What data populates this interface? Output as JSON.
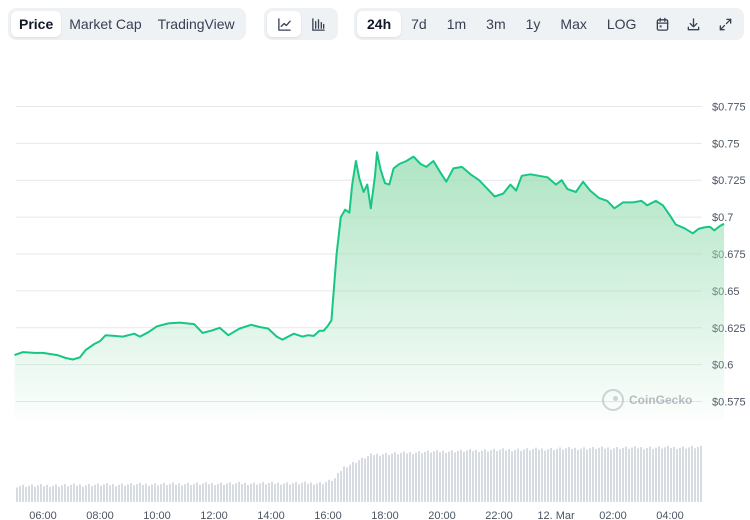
{
  "toolbar": {
    "view_tabs": [
      {
        "label": "Price",
        "active": true
      },
      {
        "label": "Market Cap",
        "active": false
      },
      {
        "label": "TradingView",
        "active": false
      }
    ],
    "chart_type_icons": [
      "line-chart-icon",
      "candlestick-chart-icon"
    ],
    "ranges": [
      {
        "label": "24h",
        "active": true
      },
      {
        "label": "7d",
        "active": false
      },
      {
        "label": "1m",
        "active": false
      },
      {
        "label": "3m",
        "active": false
      },
      {
        "label": "1y",
        "active": false
      },
      {
        "label": "Max",
        "active": false
      },
      {
        "label": "LOG",
        "active": false
      }
    ],
    "utility_icons": [
      "calendar-icon",
      "download-icon",
      "expand-icon"
    ]
  },
  "watermark": "CoinGecko",
  "colors": {
    "line": "#16c784",
    "fill_top": "#9fdfb8",
    "volume": "#d7dce2",
    "grid": "#e5e7eb"
  },
  "chart_data": {
    "type": "area",
    "x_labels": [
      "06:00",
      "08:00",
      "10:00",
      "12:00",
      "14:00",
      "16:00",
      "18:00",
      "20:00",
      "22:00",
      "12. Mar",
      "02:00",
      "04:00"
    ],
    "y_ticks": [
      "$0.575",
      "$0.6",
      "$0.625",
      "$0.65",
      "$0.675",
      "$0.7",
      "$0.725",
      "$0.75",
      "$0.775"
    ],
    "y_tick_values": [
      0.575,
      0.6,
      0.625,
      0.65,
      0.675,
      0.7,
      0.725,
      0.75,
      0.775
    ],
    "ylim": [
      0.5625,
      0.7875
    ],
    "xlim_hours": [
      5.0,
      29.0
    ],
    "grid": true,
    "price": [
      [
        5.0,
        0.6065
      ],
      [
        5.3,
        0.6085
      ],
      [
        5.7,
        0.608
      ],
      [
        6.0,
        0.608
      ],
      [
        6.5,
        0.6065
      ],
      [
        6.8,
        0.6045
      ],
      [
        7.05,
        0.6035
      ],
      [
        7.3,
        0.605
      ],
      [
        7.5,
        0.61
      ],
      [
        7.8,
        0.614
      ],
      [
        8.0,
        0.616
      ],
      [
        8.2,
        0.62
      ],
      [
        8.5,
        0.6195
      ],
      [
        8.8,
        0.619
      ],
      [
        9.0,
        0.62
      ],
      [
        9.2,
        0.621
      ],
      [
        9.4,
        0.619
      ],
      [
        9.7,
        0.622
      ],
      [
        10.0,
        0.626
      ],
      [
        10.4,
        0.628
      ],
      [
        10.8,
        0.6285
      ],
      [
        11.3,
        0.6275
      ],
      [
        11.6,
        0.6215
      ],
      [
        11.9,
        0.623
      ],
      [
        12.2,
        0.625
      ],
      [
        12.5,
        0.62
      ],
      [
        12.9,
        0.6245
      ],
      [
        13.3,
        0.627
      ],
      [
        13.6,
        0.6255
      ],
      [
        13.9,
        0.6245
      ],
      [
        14.2,
        0.619
      ],
      [
        14.4,
        0.617
      ],
      [
        14.8,
        0.621
      ],
      [
        15.1,
        0.619
      ],
      [
        15.3,
        0.62
      ],
      [
        15.5,
        0.6195
      ],
      [
        15.7,
        0.623
      ],
      [
        15.85,
        0.623
      ],
      [
        16.0,
        0.6265
      ],
      [
        16.12,
        0.63
      ],
      [
        16.3,
        0.675
      ],
      [
        16.45,
        0.7
      ],
      [
        16.6,
        0.705
      ],
      [
        16.75,
        0.703
      ],
      [
        16.85,
        0.722
      ],
      [
        16.98,
        0.738
      ],
      [
        17.1,
        0.726
      ],
      [
        17.25,
        0.717
      ],
      [
        17.38,
        0.722
      ],
      [
        17.5,
        0.706
      ],
      [
        17.65,
        0.728
      ],
      [
        17.72,
        0.744
      ],
      [
        17.85,
        0.732
      ],
      [
        18.0,
        0.723
      ],
      [
        18.15,
        0.722
      ],
      [
        18.3,
        0.733
      ],
      [
        18.5,
        0.736
      ],
      [
        18.75,
        0.738
      ],
      [
        19.0,
        0.741
      ],
      [
        19.25,
        0.736
      ],
      [
        19.45,
        0.734
      ],
      [
        19.7,
        0.738
      ],
      [
        19.95,
        0.73
      ],
      [
        20.15,
        0.724
      ],
      [
        20.4,
        0.733
      ],
      [
        20.7,
        0.734
      ],
      [
        21.0,
        0.729
      ],
      [
        21.3,
        0.725
      ],
      [
        21.6,
        0.719
      ],
      [
        21.85,
        0.714
      ],
      [
        22.15,
        0.716
      ],
      [
        22.4,
        0.722
      ],
      [
        22.6,
        0.718
      ],
      [
        22.8,
        0.728
      ],
      [
        23.1,
        0.729
      ],
      [
        23.4,
        0.728
      ],
      [
        23.7,
        0.727
      ],
      [
        24.0,
        0.722
      ],
      [
        24.2,
        0.725
      ],
      [
        24.4,
        0.719
      ],
      [
        24.7,
        0.717
      ],
      [
        24.95,
        0.724
      ],
      [
        25.2,
        0.718
      ],
      [
        25.5,
        0.713
      ],
      [
        25.8,
        0.711
      ],
      [
        26.05,
        0.706
      ],
      [
        26.35,
        0.71
      ],
      [
        26.7,
        0.71
      ],
      [
        27.0,
        0.711
      ],
      [
        27.2,
        0.708
      ],
      [
        27.5,
        0.711
      ],
      [
        27.75,
        0.708
      ],
      [
        28.0,
        0.701
      ],
      [
        28.2,
        0.695
      ],
      [
        28.5,
        0.6925
      ],
      [
        28.8,
        0.689
      ],
      [
        29.0,
        0.692
      ],
      [
        29.2,
        0.693
      ],
      [
        29.4,
        0.6935
      ],
      [
        29.55,
        0.691
      ],
      [
        29.75,
        0.694
      ],
      [
        29.9,
        0.6955
      ]
    ],
    "volume_relative": [
      [
        5.0,
        0.28
      ],
      [
        8.0,
        0.3
      ],
      [
        12.0,
        0.32
      ],
      [
        15.8,
        0.33
      ],
      [
        16.2,
        0.4
      ],
      [
        16.5,
        0.6
      ],
      [
        17.5,
        0.82
      ],
      [
        19.5,
        0.87
      ],
      [
        22.0,
        0.9
      ],
      [
        25.0,
        0.93
      ],
      [
        29.9,
        0.95
      ]
    ]
  }
}
